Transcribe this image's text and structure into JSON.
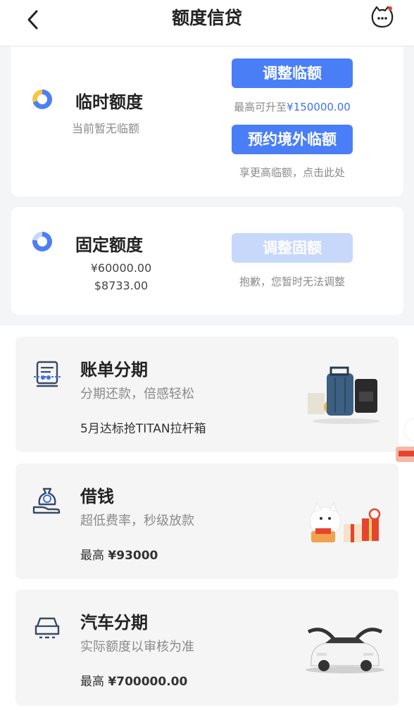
{
  "header": {
    "title": "额度信贷",
    "back_icon": "back-arrow-icon",
    "service_icon": "cat-service-icon"
  },
  "temp_limit": {
    "label": "临时额度",
    "status": "当前暂无临额",
    "adjust_button": "调整临额",
    "max_prefix": "最高可升至",
    "max_value": "¥150000.00",
    "overseas_button": "预约境外临额",
    "overseas_note": "享更高临额，点击此处"
  },
  "fixed_limit": {
    "label": "固定额度",
    "total": "¥60000.00",
    "available": "$8733.00",
    "adjust_button": "调整固额",
    "note": "抱歉，您暂时无法调整"
  },
  "services": [
    {
      "title": "账单分期",
      "subtitle": "分期还款，倍感轻松",
      "extra": "5月达标抢TITAN拉杆箱",
      "icon": "bill-installment-icon",
      "image": "luggage-illustration"
    },
    {
      "title": "借钱",
      "subtitle": "超低费率，秒级放款",
      "extra_prefix": "最高 ",
      "extra_value": "¥93000",
      "icon": "money-bag-hand-icon",
      "image": "lucky-cat-gifts-illustration"
    },
    {
      "title": "汽车分期",
      "subtitle": "实际额度以审核为准",
      "extra_prefix": "最高 ",
      "extra_value": "¥700000.00",
      "icon": "car-icon",
      "image": "white-suv-illustration"
    }
  ],
  "colors": {
    "primary": "#4a7ef7",
    "disabled": "#c7d8fb",
    "highlight": "#3e72e6"
  }
}
